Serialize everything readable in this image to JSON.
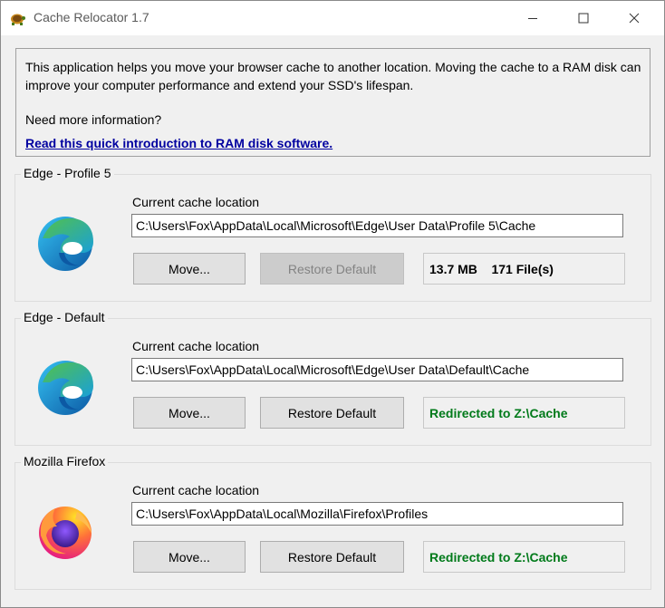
{
  "window": {
    "title": "Cache Relocator 1.7",
    "controls": [
      "minimize-icon",
      "maximize-icon",
      "close-icon"
    ]
  },
  "info": {
    "text": "This application helps you move your browser cache to another location. Moving the cache to a RAM disk can improve your computer performance and extend your SSD's lifespan.",
    "question": "Need more information?",
    "link": "Read this quick introduction to RAM disk software."
  },
  "browsers": [
    {
      "name": "Edge - Profile 5",
      "icon": "edge-icon",
      "location_label": "Current cache location",
      "location": "C:\\Users\\Fox\\AppData\\Local\\Microsoft\\Edge\\User Data\\Profile 5\\Cache",
      "move_label": "Move...",
      "restore_label": "Restore Default",
      "restore_enabled": false,
      "status": "13.7 MB    171 File(s)"
    },
    {
      "name": "Edge - Default",
      "icon": "edge-icon",
      "location_label": "Current cache location",
      "location": "C:\\Users\\Fox\\AppData\\Local\\Microsoft\\Edge\\User Data\\Default\\Cache",
      "move_label": "Move...",
      "restore_label": "Restore Default",
      "restore_enabled": true,
      "status": "Redirected to Z:\\Cache"
    },
    {
      "name": "Mozilla Firefox",
      "icon": "firefox-icon",
      "location_label": "Current cache location",
      "location": "C:\\Users\\Fox\\AppData\\Local\\Mozilla\\Firefox\\Profiles",
      "move_label": "Move...",
      "restore_label": "Restore Default",
      "restore_enabled": true,
      "status": "Redirected to Z:\\Cache"
    }
  ],
  "colors": {
    "link": "#0000a0",
    "redirect_status": "#007a1a",
    "edge_blue": "#0c59a4",
    "edge_green": "#52c14b",
    "firefox_orange": "#ff7139"
  }
}
